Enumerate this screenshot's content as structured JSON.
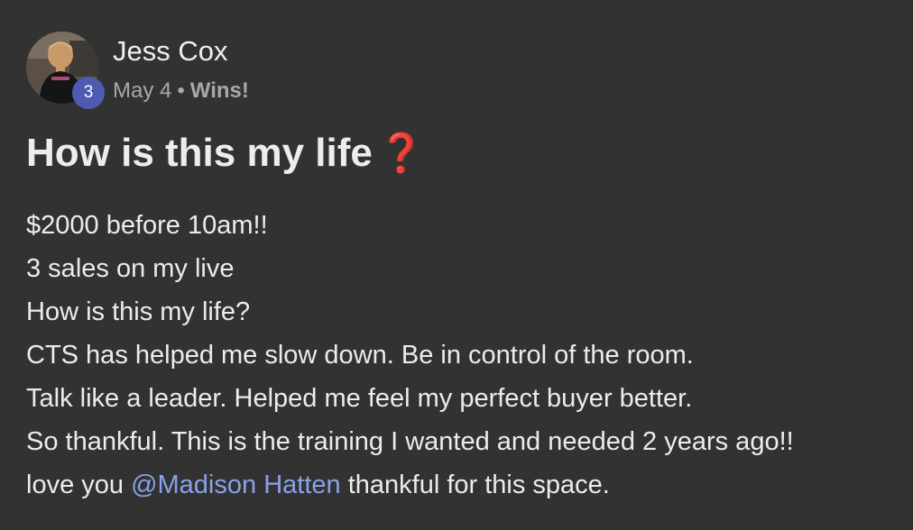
{
  "author": {
    "name": "Jess Cox",
    "level": "3",
    "date": "May 4",
    "separator": "•",
    "category": "Wins!"
  },
  "post": {
    "title": "How is this my life",
    "title_icon": "red-question-mark-icon",
    "title_icon_glyph": "❓",
    "lines": [
      "$2000 before 10am!!",
      "3 sales on my live",
      "How is this my life?",
      "CTS has helped me slow down. Be in control of the room.",
      "Talk like a leader. Helped me feel my perfect buyer better.",
      "So thankful. This is the training I wanted and needed 2 years ago!!"
    ],
    "last_line": {
      "prefix": "love you ",
      "mention": "@Madison Hatten",
      "suffix": " thankful for this space."
    }
  },
  "colors": {
    "background": "#323233",
    "text": "#ececec",
    "muted": "#a8a8a8",
    "badge": "#4e5bb0",
    "mention": "#8aa1e6",
    "accent_red": "#d62c2c"
  }
}
